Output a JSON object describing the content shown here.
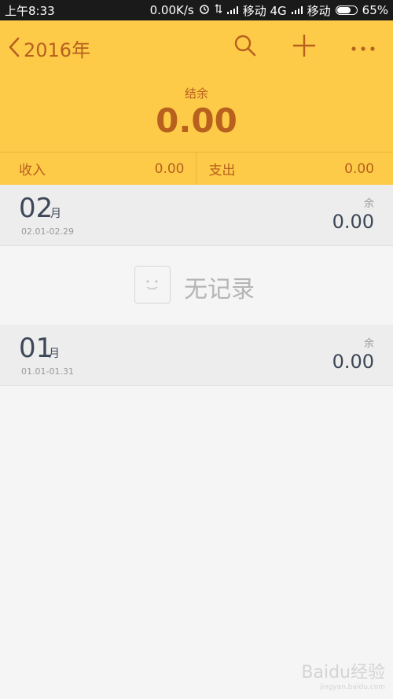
{
  "status": {
    "time": "上午8:33",
    "speed": "0.00K/s",
    "carrier1": "移动 4G",
    "carrier2": "移动",
    "battery": "65%"
  },
  "header": {
    "year": "2016年",
    "balance_label": "结余",
    "balance_value": "0.00",
    "income_label": "收入",
    "income_value": "0.00",
    "expense_label": "支出",
    "expense_value": "0.00"
  },
  "months": [
    {
      "number": "02",
      "unit": "月",
      "range": "02.01-02.29",
      "remaining_label": "余",
      "remaining_value": "0.00"
    },
    {
      "number": "01",
      "unit": "月",
      "range": "01.01-01.31",
      "remaining_label": "余",
      "remaining_value": "0.00"
    }
  ],
  "empty_state": {
    "label": "无记录"
  },
  "watermark": {
    "text": "Baidu经验",
    "url": "jingyan.baidu.com"
  }
}
